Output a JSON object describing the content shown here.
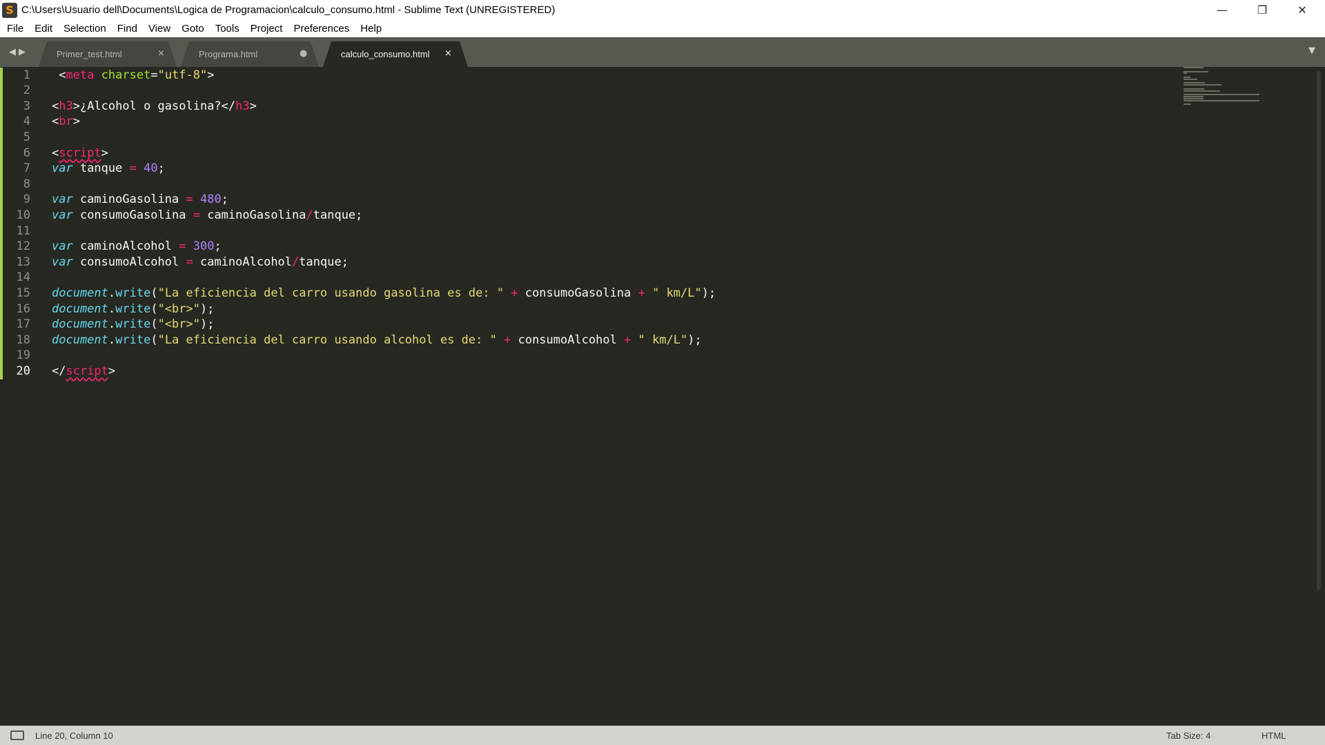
{
  "window": {
    "title": "C:\\Users\\Usuario dell\\Documents\\Logica de Programacion\\calculo_consumo.html - Sublime Text (UNREGISTERED)",
    "app_icon": "sublime-text-icon",
    "minimize_glyph": "—",
    "maximize_glyph": "❐",
    "close_glyph": "✕"
  },
  "menu": [
    "File",
    "Edit",
    "Selection",
    "Find",
    "View",
    "Goto",
    "Tools",
    "Project",
    "Preferences",
    "Help"
  ],
  "tabs": [
    {
      "label": "Primer_test.html",
      "state": "inactive",
      "control": "×"
    },
    {
      "label": "Programa.html",
      "state": "inactive-dirty",
      "control": "●"
    },
    {
      "label": "calculo_consumo.html",
      "state": "active",
      "control": "×"
    }
  ],
  "tab_nav_glyph": "◀▶",
  "tab_dropdown_glyph": "▼",
  "editor": {
    "current_line": 20,
    "line_numbers": [
      "1",
      "2",
      "3",
      "4",
      "5",
      "6",
      "7",
      "8",
      "9",
      "10",
      "11",
      "12",
      "13",
      "14",
      "15",
      "16",
      "17",
      "18",
      "19",
      "20"
    ],
    "lines": [
      [
        {
          "t": " <",
          "c": ""
        },
        {
          "t": "meta",
          "c": "tag"
        },
        {
          "t": " ",
          "c": ""
        },
        {
          "t": "charset",
          "c": "attr"
        },
        {
          "t": "=",
          "c": ""
        },
        {
          "t": "\"utf-8\"",
          "c": "str"
        },
        {
          "t": ">",
          "c": ""
        }
      ],
      [],
      [
        {
          "t": "<",
          "c": ""
        },
        {
          "t": "h3",
          "c": "tag"
        },
        {
          "t": ">¿Alcohol o gasolina?</",
          "c": ""
        },
        {
          "t": "h3",
          "c": "tag"
        },
        {
          "t": ">",
          "c": ""
        }
      ],
      [
        {
          "t": "<",
          "c": ""
        },
        {
          "t": "br",
          "c": "tag"
        },
        {
          "t": ">",
          "c": ""
        }
      ],
      [],
      [
        {
          "t": "<",
          "c": ""
        },
        {
          "t": "script",
          "c": "tag err"
        },
        {
          "t": ">",
          "c": ""
        }
      ],
      [
        {
          "t": "var",
          "c": "kw"
        },
        {
          "t": " tanque ",
          "c": ""
        },
        {
          "t": "=",
          "c": "op"
        },
        {
          "t": " ",
          "c": ""
        },
        {
          "t": "40",
          "c": "num"
        },
        {
          "t": ";",
          "c": ""
        }
      ],
      [],
      [
        {
          "t": "var",
          "c": "kw"
        },
        {
          "t": " caminoGasolina ",
          "c": ""
        },
        {
          "t": "=",
          "c": "op"
        },
        {
          "t": " ",
          "c": ""
        },
        {
          "t": "480",
          "c": "num"
        },
        {
          "t": ";",
          "c": ""
        }
      ],
      [
        {
          "t": "var",
          "c": "kw"
        },
        {
          "t": " consumoGasolina ",
          "c": ""
        },
        {
          "t": "=",
          "c": "op"
        },
        {
          "t": " caminoGasolina",
          "c": ""
        },
        {
          "t": "/",
          "c": "op"
        },
        {
          "t": "tanque;",
          "c": ""
        }
      ],
      [],
      [
        {
          "t": "var",
          "c": "kw"
        },
        {
          "t": " caminoAlcohol ",
          "c": ""
        },
        {
          "t": "=",
          "c": "op"
        },
        {
          "t": " ",
          "c": ""
        },
        {
          "t": "300",
          "c": "num"
        },
        {
          "t": ";",
          "c": ""
        }
      ],
      [
        {
          "t": "var",
          "c": "kw"
        },
        {
          "t": " consumoAlcohol ",
          "c": ""
        },
        {
          "t": "=",
          "c": "op"
        },
        {
          "t": " caminoAlcohol",
          "c": ""
        },
        {
          "t": "/",
          "c": "op"
        },
        {
          "t": "tanque;",
          "c": ""
        }
      ],
      [],
      [
        {
          "t": "document",
          "c": "obj"
        },
        {
          "t": ".",
          "c": ""
        },
        {
          "t": "write",
          "c": "fn"
        },
        {
          "t": "(",
          "c": ""
        },
        {
          "t": "\"La eficiencia del carro usando gasolina es de: \"",
          "c": "str"
        },
        {
          "t": " ",
          "c": ""
        },
        {
          "t": "+",
          "c": "op"
        },
        {
          "t": " consumoGasolina ",
          "c": ""
        },
        {
          "t": "+",
          "c": "op"
        },
        {
          "t": " ",
          "c": ""
        },
        {
          "t": "\" km/L\"",
          "c": "str"
        },
        {
          "t": ");",
          "c": ""
        }
      ],
      [
        {
          "t": "document",
          "c": "obj"
        },
        {
          "t": ".",
          "c": ""
        },
        {
          "t": "write",
          "c": "fn"
        },
        {
          "t": "(",
          "c": ""
        },
        {
          "t": "\"<br>\"",
          "c": "str"
        },
        {
          "t": ");",
          "c": ""
        }
      ],
      [
        {
          "t": "document",
          "c": "obj"
        },
        {
          "t": ".",
          "c": ""
        },
        {
          "t": "write",
          "c": "fn"
        },
        {
          "t": "(",
          "c": ""
        },
        {
          "t": "\"<br>\"",
          "c": "str"
        },
        {
          "t": ");",
          "c": ""
        }
      ],
      [
        {
          "t": "document",
          "c": "obj"
        },
        {
          "t": ".",
          "c": ""
        },
        {
          "t": "write",
          "c": "fn"
        },
        {
          "t": "(",
          "c": ""
        },
        {
          "t": "\"La eficiencia del carro usando alcohol es de: \"",
          "c": "str"
        },
        {
          "t": " ",
          "c": ""
        },
        {
          "t": "+",
          "c": "op"
        },
        {
          "t": " consumoAlcohol ",
          "c": ""
        },
        {
          "t": "+",
          "c": "op"
        },
        {
          "t": " ",
          "c": ""
        },
        {
          "t": "\" km/L\"",
          "c": "str"
        },
        {
          "t": ");",
          "c": ""
        }
      ],
      [],
      [
        {
          "t": "</",
          "c": ""
        },
        {
          "t": "script",
          "c": "tag err"
        },
        {
          "t": ">",
          "c": ""
        }
      ]
    ]
  },
  "status": {
    "position": "Line 20, Column 10",
    "tab_size": "Tab Size: 4",
    "syntax": "HTML"
  },
  "colors": {
    "editor_bg": "#272822",
    "tag": "#f92672",
    "string": "#e6db74",
    "keyword": "#66d9ef",
    "number": "#ae81ff",
    "attribute": "#a6e22e",
    "gutter_modified": "#a6d34a"
  }
}
